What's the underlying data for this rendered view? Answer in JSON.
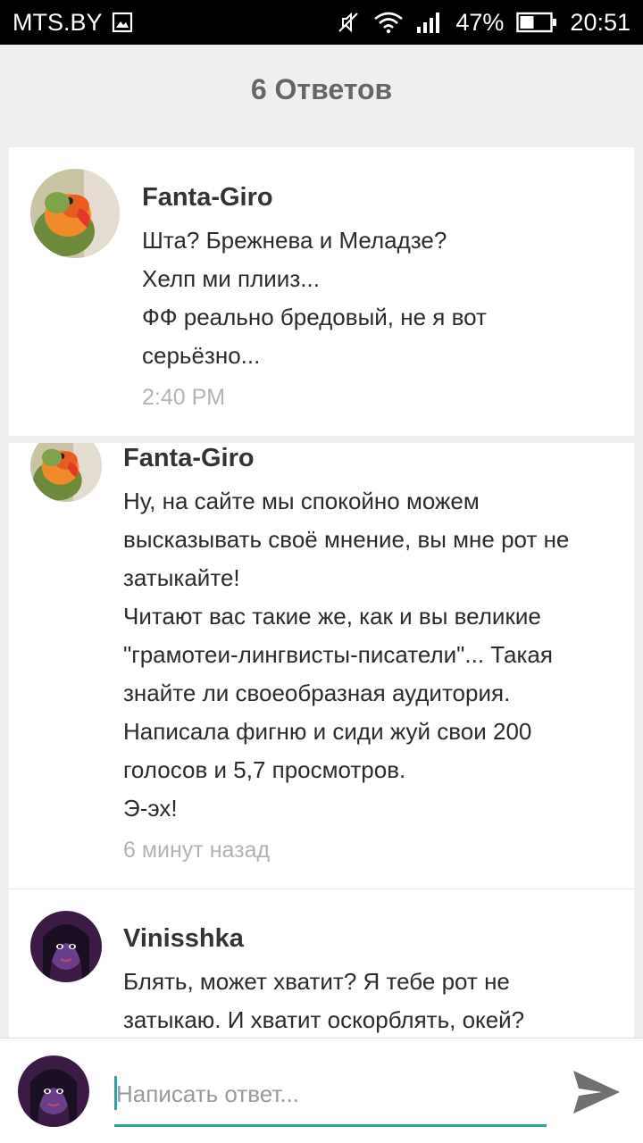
{
  "status_bar": {
    "carrier": "MTS.BY",
    "battery_percent": "47%",
    "battery_level": 0.47,
    "time": "20:51",
    "icons": [
      "image-icon",
      "mute-icon",
      "wifi-icon",
      "signal-icon",
      "battery-icon"
    ]
  },
  "header": {
    "title": "6 Ответов"
  },
  "original_post": {
    "author": "Fanta-Giro",
    "lines": [
      "Шта? Брежнева и Меладзе?",
      "Хелп ми плииз...",
      "ФФ реально бредовый, не я вот",
      "серьёзно..."
    ],
    "time": "2:40 PM",
    "avatar": "parrot-avatar"
  },
  "replies": [
    {
      "author": "Fanta-Giro",
      "lines": [
        "Ну, на сайте мы спокойно можем",
        "высказывать своё мнение, вы мне рот не",
        "затыкайте!",
        "Читают вас такие же, как и вы великие",
        "\"грамотеи-лингвисты-писатели\"... Такая",
        "знайте ли своеобразная аудитория.",
        "Написала фигню и сиди жуй свои 200",
        "голосов и 5,7 просмотров.",
        "Э-эх!"
      ],
      "time": "6 минут назад",
      "avatar": "parrot-avatar"
    },
    {
      "author": "Vinisshka",
      "lines": [
        "Блять, может хватит? Я тебе рот не",
        "затыкаю. И хватит оскорблять, окей?"
      ],
      "time": "",
      "avatar": "jasmine-avatar"
    }
  ],
  "composer": {
    "placeholder": "Написать ответ...",
    "value": "",
    "avatar": "jasmine-avatar",
    "send_icon": "send-icon"
  },
  "colors": {
    "accent": "#2aa3a3",
    "background": "#efefef",
    "timestamp": "#b3b3b3"
  }
}
